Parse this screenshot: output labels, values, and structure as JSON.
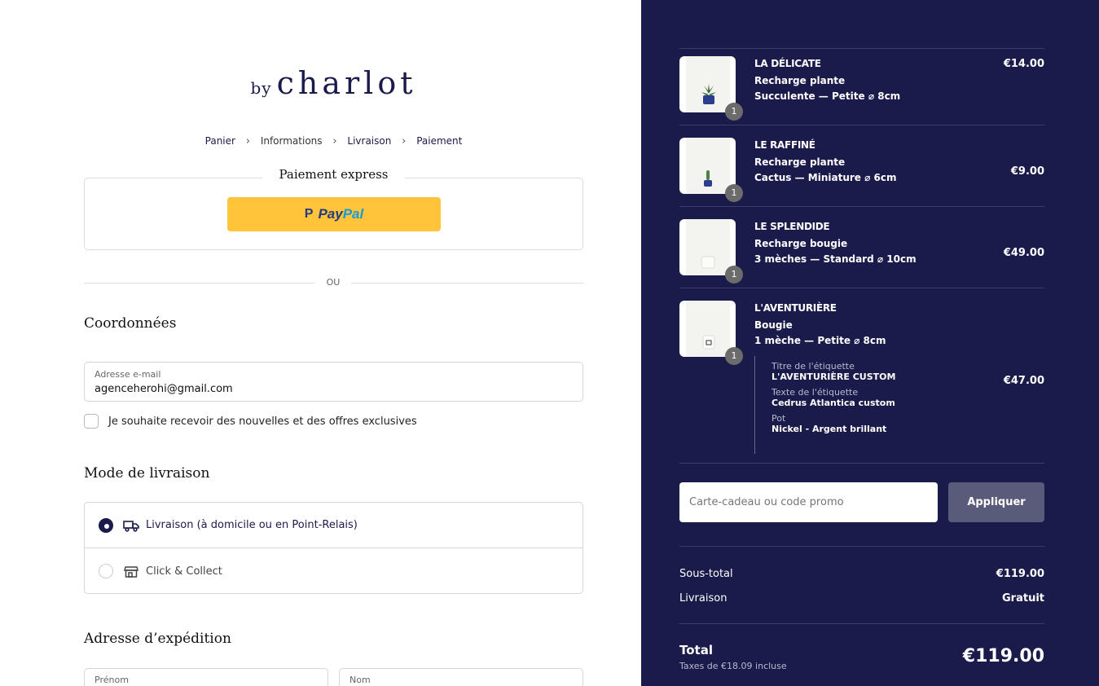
{
  "brand": {
    "by": "by",
    "name": "charlot"
  },
  "breadcrumb": [
    {
      "label": "Panier"
    },
    {
      "label": "Informations"
    },
    {
      "label": "Livraison"
    },
    {
      "label": "Paiement"
    }
  ],
  "express": {
    "title": "Paiement express",
    "paypal_a": "Pay",
    "paypal_b": "Pal",
    "paypal_mark": "P"
  },
  "separator": "OU",
  "contact": {
    "title": "Coordonnées",
    "email_label": "Adresse e-mail",
    "email_value": "agenceherohi@gmail.com",
    "newsletter_label": "Je souhaite recevoir des nouvelles et des offres exclusives"
  },
  "shipping_method": {
    "title": "Mode de livraison",
    "options": [
      {
        "label": "Livraison (à domicile ou en Point-Relais)",
        "icon": "truck-icon",
        "selected": true
      },
      {
        "label": "Click & Collect",
        "icon": "store-icon",
        "selected": false
      }
    ]
  },
  "shipping_address": {
    "title": "Adresse d’expédition",
    "first_name_label": "Prénom",
    "last_name_label": "Nom"
  },
  "cart": {
    "items": [
      {
        "name": "LA DÉLICATE",
        "type": "Recharge plante",
        "variant": "Succulente — Petite ⌀ 8cm",
        "qty": "1",
        "price": "€14.00"
      },
      {
        "name": "LE RAFFINÉ",
        "type": "Recharge plante",
        "variant": "Cactus — Miniature   ⌀ 6cm",
        "qty": "1",
        "price": "€9.00"
      },
      {
        "name": "LE SPLENDIDE",
        "type": "Recharge bougie",
        "variant": "3 mèches  —  Standard  ⌀ 10cm",
        "qty": "1",
        "price": "€49.00"
      },
      {
        "name": "L'AVENTURIÈRE",
        "type": "Bougie",
        "variant": "1 mèche  —  Petite  ⌀ 8cm",
        "qty": "1",
        "price": "€47.00",
        "properties": [
          {
            "label": "Titre de l'étiquette",
            "value": "L'AVENTURIÈRE CUSTOM"
          },
          {
            "label": "Texte de l'étiquette",
            "value": "Cedrus Atlantica custom"
          },
          {
            "label": "Pot",
            "value": "Nickel - Argent brillant"
          }
        ]
      }
    ],
    "promo_placeholder": "Carte-cadeau ou code promo",
    "apply_label": "Appliquer",
    "subtotal_label": "Sous-total",
    "subtotal_value": "€119.00",
    "shipping_label": "Livraison",
    "shipping_value": "Gratuit",
    "total_label": "Total",
    "tax_note": "Taxes de €18.09 incluse",
    "total_value": "€119.00"
  },
  "colors": {
    "navy": "#1b1b4b",
    "paypal_yellow": "#ffc439",
    "paypal_blue_dark": "#253b80",
    "paypal_blue_light": "#179bd7"
  }
}
